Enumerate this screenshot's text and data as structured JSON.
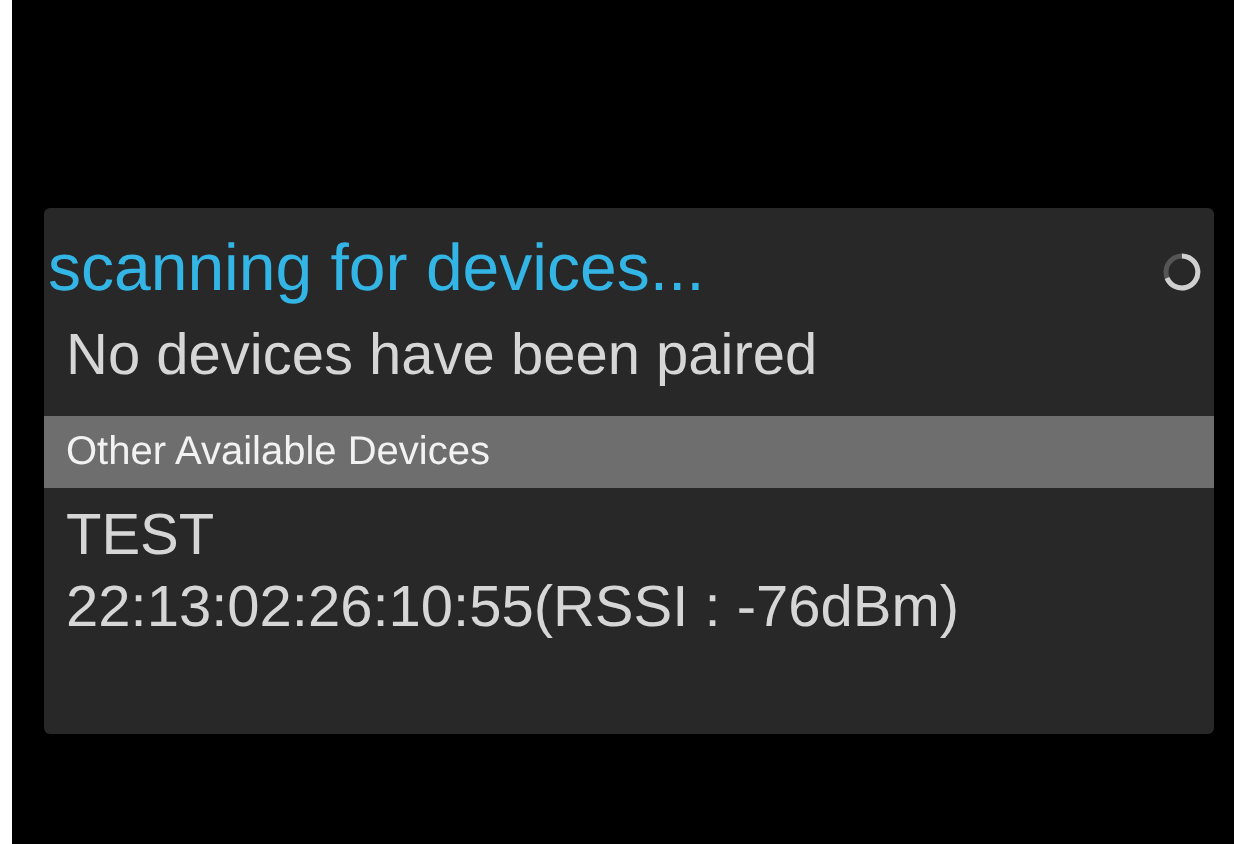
{
  "dialog": {
    "title": "scanning for devices...",
    "progress": {
      "kind": "spinner"
    }
  },
  "paired_message": "No devices have been paired",
  "section_header": "Other Available Devices",
  "devices": [
    {
      "name": "TEST",
      "address": "22:13:02:26:10:55(RSSI : -76dBm)"
    }
  ]
}
